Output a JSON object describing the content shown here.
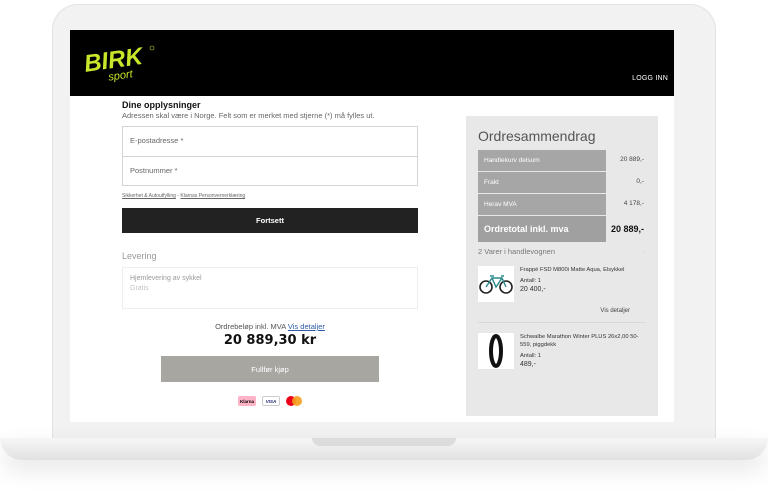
{
  "header": {
    "logo_text": "BIRK sport",
    "login_label": "LOGG INN"
  },
  "info": {
    "title": "Dine opplysninger",
    "subtitle": "Adressen skal være i Norge. Felt som er merket med stjerne (*) må fylles ut.",
    "email_placeholder": "E-postadresse *",
    "postal_placeholder": "Postnummer *",
    "legal_link_1": "Sikkerhet & Autoutfylling",
    "legal_sep": " - ",
    "legal_link_2": "Klarnas Personvernerklæring",
    "continue_label": "Fortsett"
  },
  "delivery": {
    "title": "Levering",
    "method": "Hjemlevering av sykkel",
    "price": "Gratis"
  },
  "checkout": {
    "total_label": "Ordrebeløp inkl. MVA",
    "details_link": "Vis detaljer",
    "total_amount": "20 889,30 kr",
    "complete_label": "Fullfør kjøp",
    "payment_logos": [
      "Klarna",
      "VISA",
      "mastercard"
    ]
  },
  "summary": {
    "title": "Ordresammendrag",
    "rows": [
      {
        "label": "Handlekurv delsum",
        "value": "20 889,-"
      },
      {
        "label": "Frakt",
        "value": "0,-"
      },
      {
        "label": "Herav MVA",
        "value": "4 178,-"
      }
    ],
    "total_label": "Ordretotal inkl. mva",
    "total_value": "20 889,-",
    "cart_count": "2 Varer i handlevognen",
    "items": [
      {
        "name": "Frappé FSD M800i Matte Aqua, Elsykkel",
        "qty": "Antall: 1",
        "price": "20 400,-",
        "details": "Vis detaljer",
        "icon": "bicycle-icon"
      },
      {
        "name": "Schwalbe Marathon Winter PLUS 26x2,00 50-559, piggdekk",
        "qty": "Antall: 1",
        "price": "489,-",
        "icon": "tire-icon"
      }
    ]
  },
  "colors": {
    "header_bg": "#000000",
    "logo_accent": "#c8e62a",
    "button_dark": "#222222",
    "button_disabled": "#a8a6a1",
    "summary_bg": "#e8e8e8",
    "summary_label_bg": "#a6a6a6"
  }
}
